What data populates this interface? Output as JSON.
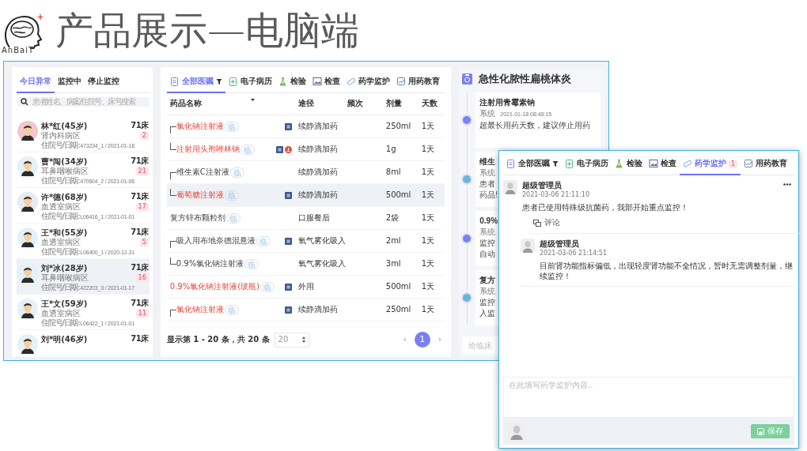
{
  "slide": {
    "logo_text": "AnBaiT",
    "title": "产品展示—电脑端"
  },
  "patients_panel": {
    "tabs": [
      {
        "label": "今日异常",
        "selected": true
      },
      {
        "label": "监控中",
        "selected": false
      },
      {
        "label": "停止监控",
        "selected": false
      }
    ],
    "search": {
      "placeholder": "患者姓名、病案/住院号、床号搜索"
    },
    "patients": [
      {
        "name": "林*红(45岁)",
        "ward": "肾内科病区",
        "id_label": "住院号/日期:",
        "id": "473234_1 / 2021-01-18",
        "bed": "71床",
        "count": "2",
        "selected": false,
        "color": "#f2c6ca"
      },
      {
        "name": "曹*闯(34岁)",
        "ward": "耳鼻咽喉病区",
        "id_label": "住院号/日期:",
        "id": "470604_2 / 2021-01-06",
        "bed": "71床",
        "count": "21",
        "selected": false,
        "color": "#e3f1fb"
      },
      {
        "name": "许*德(68岁)",
        "ward": "血透室病区",
        "id_label": "住院号/日期:",
        "id": "L06416_1 / 2021-01-01",
        "bed": "71床",
        "count": "17",
        "selected": false,
        "color": "#e6eaf2"
      },
      {
        "name": "王*和(55岁)",
        "ward": "血透室病区",
        "id_label": "住院号/日期:",
        "id": "L06400_1 / 2020-12-31",
        "bed": "71床",
        "count": "5",
        "selected": false,
        "color": "#e3f1fb"
      },
      {
        "name": "刘*冰(28岁)",
        "ward": "耳鼻咽喉病区",
        "id_label": "住院号/日期:",
        "id": "422203_3 / 2021-01-17",
        "bed": "71床",
        "count": "16",
        "selected": true,
        "color": "#e3f1fb"
      },
      {
        "name": "王*文(59岁)",
        "ward": "血透室病区",
        "id_label": "住院号/日期:",
        "id": "L06422_1 / 2021-01-01",
        "bed": "71床",
        "count": "11",
        "selected": false,
        "color": "#e3f1fb"
      },
      {
        "name": "刘*明(46岁)",
        "bed": "71床",
        "selected": false,
        "color": "#e3f1fb"
      }
    ]
  },
  "orders_panel": {
    "tabs": [
      {
        "label": "全部医嘱",
        "selected": true,
        "filter": true
      },
      {
        "label": "电子病历",
        "selected": false
      },
      {
        "label": "检验",
        "selected": false
      },
      {
        "label": "检查",
        "selected": false
      },
      {
        "label": "药学监护",
        "selected": false
      },
      {
        "label": "用药教育",
        "selected": false
      }
    ],
    "columns": [
      "药品名称",
      "途径",
      "频次",
      "剂量",
      "天数"
    ],
    "rows": [
      {
        "name": "氯化钠注射液",
        "tag": "临",
        "highlight": true,
        "tree_first": true,
        "tree_last": false,
        "flag": true,
        "alert": false,
        "route": "续静滴加药",
        "dose": "250ml",
        "days": "1天",
        "selected": false
      },
      {
        "name": "注射用头孢唑林钠",
        "tag": "临",
        "highlight": true,
        "tree_first": false,
        "tree_last": true,
        "flag": true,
        "alert": true,
        "route": "续静滴加药",
        "dose": "1g",
        "days": "1天",
        "selected": false
      },
      {
        "name": "维生素C注射液",
        "tag": "临",
        "highlight": false,
        "tree_first": true,
        "tree_last": false,
        "flag": false,
        "alert": false,
        "route": "续静滴加药",
        "dose": "8ml",
        "days": "1天",
        "selected": false
      },
      {
        "name": "葡萄糖注射液",
        "tag": "临",
        "highlight": true,
        "tree_first": false,
        "tree_last": true,
        "flag": true,
        "alert": false,
        "route": "续静滴加药",
        "dose": "500ml",
        "days": "1天",
        "selected": true
      },
      {
        "name": "复方锌布颗粒剂",
        "tag": "临",
        "highlight": false,
        "tree_first": false,
        "tree_last": false,
        "flag": false,
        "alert": false,
        "route": "口服餐后",
        "dose": "2袋",
        "days": "1天",
        "selected": false
      },
      {
        "name": "吸入用布地奈德混悬液",
        "tag": "临",
        "highlight": false,
        "tree_first": true,
        "tree_last": false,
        "flag": true,
        "alert": false,
        "route": "氧气雾化吸入",
        "dose": "2ml",
        "days": "1天",
        "selected": false
      },
      {
        "name": "0.9%氯化钠注射液",
        "tag": "临",
        "highlight": false,
        "tree_first": false,
        "tree_last": true,
        "flag": false,
        "alert": false,
        "route": "氧气雾化吸入",
        "dose": "3ml",
        "days": "1天",
        "selected": false
      },
      {
        "name": "0.9%氯化钠注射液(玻瓶)",
        "tag": "临",
        "highlight": true,
        "tree_first": false,
        "tree_last": false,
        "flag": true,
        "alert": false,
        "route": "外用",
        "dose": "500ml",
        "days": "1天",
        "selected": false
      },
      {
        "name": "氯化钠注射液",
        "tag": "临",
        "highlight": true,
        "tree_first": true,
        "tree_last": false,
        "flag": true,
        "alert": false,
        "route": "续静滴加药",
        "dose": "250ml",
        "days": "1天",
        "selected": false
      }
    ],
    "footer": {
      "summary": "显示第 1 - 20 条，共 20 条",
      "page_size": "20",
      "prev": "‹",
      "pages": [
        {
          "label": "1",
          "selected": true
        }
      ],
      "next": "›"
    }
  },
  "alerts_panel": {
    "title": "急性化脓性扁桃体炎",
    "alerts": [
      {
        "title": "注射用青霉素钠",
        "source": "系统",
        "time": "2021-01-18 08:48:15",
        "lines": [
          "超最长用药天数，建议停止用药"
        ],
        "color": "#7c80f2"
      },
      {
        "title": "维生",
        "source": "系统",
        "lines": [
          "患者",
          "药品!"
        ],
        "color": "#6bb5da"
      },
      {
        "title": "0.9%",
        "source": "系统",
        "lines": [
          "监控",
          "自动"
        ],
        "color": "#7c80f2"
      },
      {
        "title": "复方",
        "source": "系统",
        "lines": [
          "监控",
          "入监"
        ],
        "color": "#6bb5da"
      }
    ],
    "input": {
      "placeholder": "给临床"
    }
  },
  "monitor_window": {
    "tabs": [
      {
        "label": "全部医嘱",
        "selected": false,
        "filter": true
      },
      {
        "label": "电子病历",
        "selected": false
      },
      {
        "label": "检验",
        "selected": false
      },
      {
        "label": "检查",
        "selected": false
      },
      {
        "label": "药学监护",
        "selected": true,
        "badge": "1"
      },
      {
        "label": "用药教育",
        "selected": false
      }
    ],
    "comments": [
      {
        "author": "超级管理员",
        "time": "2021-03-06 21:11:10",
        "text": "患者已使用特殊级抗菌药，我部开始重点监控！",
        "action": "评论",
        "replies": [
          {
            "author": "超级管理员",
            "time": "2021-03-06 21:14:51",
            "text": "目前肾功能指标偏低，出现轻度肾功能不全情况，暂时无需调整剂量，继续监控！"
          }
        ]
      }
    ],
    "editor": {
      "placeholder": "在此填写药学监护内容.."
    },
    "save_button": "保存"
  }
}
